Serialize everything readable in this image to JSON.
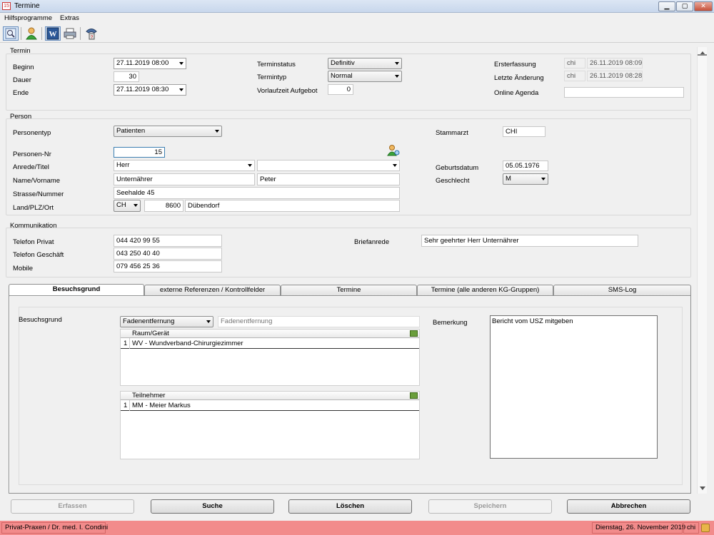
{
  "window": {
    "title": "Termine",
    "app_icon": "termine-app-icon"
  },
  "menu": [
    "Hilfsprogramme",
    "Extras"
  ],
  "toolbar": [
    "preview-icon",
    "person-icon",
    "word-icon",
    "print-icon",
    "phone-icon"
  ],
  "termin": {
    "section_label": "Termin",
    "beginn_label": "Beginn",
    "beginn_value": "27.11.2019 08:00",
    "dauer_label": "Dauer",
    "dauer_value": "30",
    "ende_label": "Ende",
    "ende_value": "27.11.2019 08:30",
    "status_label": "Terminstatus",
    "status_value": "Definitiv",
    "typ_label": "Termintyp",
    "typ_value": "Normal",
    "vorlauf_label": "Vorlaufzeit Aufgebot",
    "vorlauf_value": "0",
    "erst_label": "Ersterfassung",
    "erst_user": "chi",
    "erst_date": "26.11.2019 08:09",
    "letzte_label": "Letzte Änderung",
    "letzte_user": "chi",
    "letzte_date": "26.11.2019 08:28",
    "online_label": "Online Agenda",
    "online_value": ""
  },
  "person": {
    "section_label": "Person",
    "typ_label": "Personentyp",
    "typ_value": "Patienten",
    "nr_label": "Personen-Nr",
    "nr_value": "15",
    "anrede_label": "Anrede/Titel",
    "anrede_value": "Herr",
    "titel_value": "",
    "name_label": "Name/Vorname",
    "name_value": "Unternährer",
    "vorname_value": "Peter",
    "strasse_label": "Strasse/Nummer",
    "strasse_value": "Seehalde 45",
    "ort_label": "Land/PLZ/Ort",
    "land_value": "CH",
    "plz_value": "8600",
    "ort_value": "Dübendorf",
    "stammarzt_label": "Stammarzt",
    "stammarzt_value": "CHI",
    "geburt_label": "Geburtsdatum",
    "geburt_value": "05.05.1976",
    "geschlecht_label": "Geschlecht",
    "geschlecht_value": "M"
  },
  "komm": {
    "section_label": "Kommunikation",
    "privat_label": "Telefon Privat",
    "privat_value": "044 420 99 55",
    "geschaeft_label": "Telefon Geschäft",
    "geschaeft_value": "043 250 40 40",
    "mobile_label": "Mobile",
    "mobile_value": "079 456 25 36",
    "brief_label": "Briefanrede",
    "brief_value": "Sehr geehrter Herr Unternährer"
  },
  "tabs": [
    "Besuchsgrund",
    "externe Referenzen / Kontrollfelder",
    "Termine",
    "Termine (alle anderen KG-Gruppen)",
    "SMS-Log"
  ],
  "besuch": {
    "label": "Besuchsgrund",
    "combo_value": "Fadenentfernung",
    "text_value": "Fadenentfernung",
    "raum_header": "Raum/Gerät",
    "raum_rows": [
      {
        "n": "1",
        "text": "WV - Wundverband-Chirurgiezimmer"
      }
    ],
    "teil_header": "Teilnehmer",
    "teil_rows": [
      {
        "n": "1",
        "text": "MM - Meier Markus"
      }
    ],
    "bemerkung_label": "Bemerkung",
    "bemerkung_value": "Bericht vom USZ mitgeben"
  },
  "buttons": {
    "erfassen": "Erfassen",
    "suche": "Suche",
    "loeschen": "Löschen",
    "speichern": "Speichern",
    "abbrechen": "Abbrechen"
  },
  "status": {
    "practice": "Privat-Praxen / Dr. med. I. Condini",
    "date": "Dienstag, 26. November 2019",
    "user": "chi"
  },
  "colors": {
    "statusbar": "#f28b8b",
    "focus": "#3c7fb1"
  }
}
